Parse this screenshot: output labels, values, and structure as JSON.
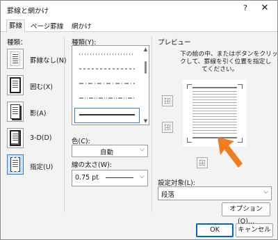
{
  "window": {
    "title": "罫線と網かけ",
    "help": "?",
    "close": "✕"
  },
  "tabs": [
    {
      "label": "罫線"
    },
    {
      "label": "ページ罫線"
    },
    {
      "label": "網かけ"
    }
  ],
  "settings": {
    "header": "種類：",
    "items": [
      {
        "label": "罫線なし(N)",
        "icon": "no-border-icon"
      },
      {
        "label": "囲む(X)",
        "icon": "box-border-icon"
      },
      {
        "label": "影(A)",
        "icon": "shadow-border-icon"
      },
      {
        "label": "3-D(D)",
        "icon": "3d-border-icon"
      },
      {
        "label": "指定(U)",
        "icon": "custom-border-icon",
        "selected": true
      }
    ]
  },
  "style": {
    "label": "種類(Y):",
    "selected_index": 4
  },
  "color": {
    "label": "色(C):",
    "value": "自動"
  },
  "width": {
    "label": "線の太さ(W):",
    "value": "0.75 pt"
  },
  "preview": {
    "label": "プレビュー",
    "instructions": [
      "下の絵の中、またはボタンをクリッ",
      "クして、罫線を引く位置を指定し",
      "てください。"
    ]
  },
  "apply_to": {
    "label": "設定対象(L):",
    "value": "段落"
  },
  "buttons": {
    "options": "オプション(O)...",
    "ok": "OK",
    "cancel": "キャンセル"
  },
  "colors": {
    "accent": "#0067c0",
    "selected_bg": "#cce4f7",
    "arrow": "#f07d1e"
  }
}
